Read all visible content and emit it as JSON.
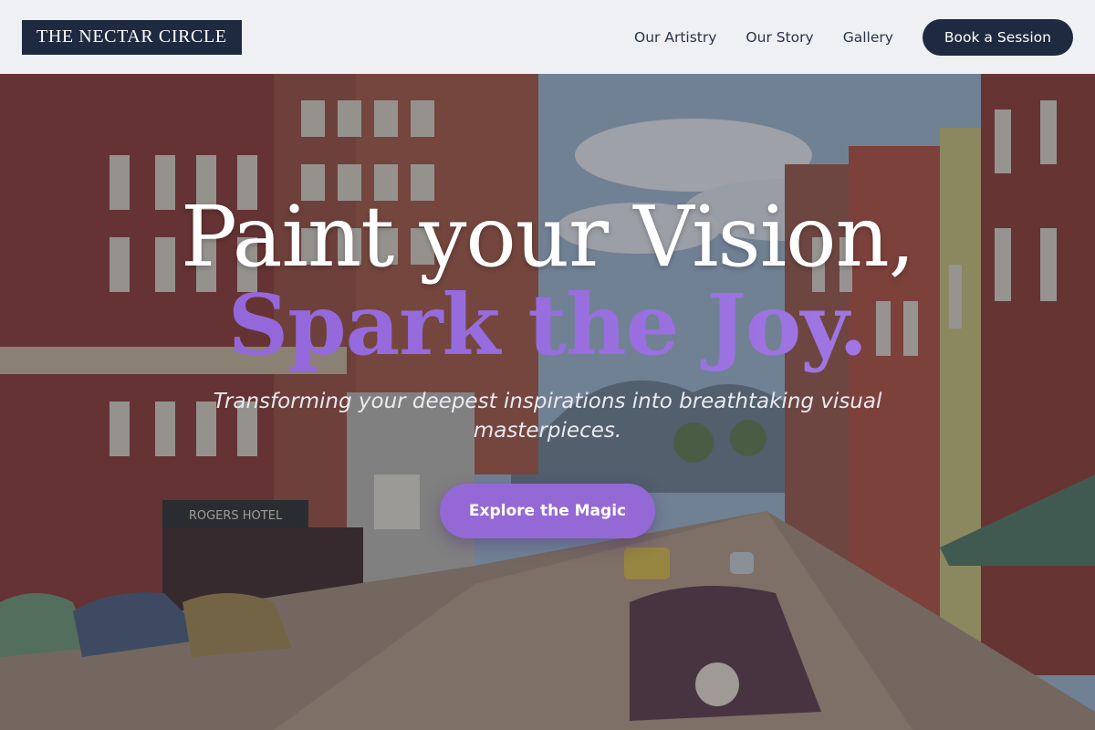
{
  "brand": {
    "name": "THE NECTAR CIRCLE"
  },
  "nav": {
    "links": [
      "Our Artistry",
      "Our Story",
      "Gallery"
    ],
    "cta_label": "Book a Session"
  },
  "hero": {
    "headline_line1": "Paint your Vision,",
    "headline_line2": "Spark the Joy.",
    "subtitle_line1": "Transforming your deepest inspirations into breathtaking visual",
    "subtitle_line2": "masterpieces.",
    "cta_label": "Explore the Magic",
    "sign_text": "ROGERS HOTEL"
  },
  "colors": {
    "navy": "#1e2a40",
    "accent_purple": "#9469d6",
    "header_bg": "#f4f5f7"
  }
}
